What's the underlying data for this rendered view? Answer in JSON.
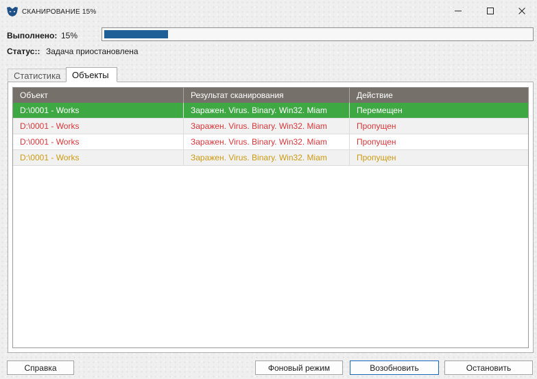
{
  "window": {
    "title": "СКАНИРОВАНИЕ 15%",
    "controls": [
      "minimize-icon",
      "maximize-icon",
      "close-icon"
    ]
  },
  "progress": {
    "label": "Выполнено:",
    "value_text": "15%",
    "value": 0.15
  },
  "status": {
    "label": "Статус::",
    "value": "Задача приостановлена"
  },
  "tabs": [
    {
      "label": "Статистика",
      "active": false
    },
    {
      "label": "Объекты",
      "active": true
    }
  ],
  "table": {
    "columns": [
      "Объект",
      "Результат сканирования",
      "Действие"
    ],
    "rows": [
      {
        "object": "D:\\0001 - Works",
        "result": "Заражен. Virus. Binary. Win32. Miam",
        "action": "Перемещен",
        "color": "#ffffff",
        "bg": "#3ea843"
      },
      {
        "object": "D:\\0001 - Works",
        "result": "Заражен. Virus. Binary. Win32. Miam",
        "action": "Пропущен",
        "color": "#d9363a",
        "bg": "#f1f1f1"
      },
      {
        "object": "D:\\0001 - Works",
        "result": "Заражен. Virus. Binary. Win32. Miam",
        "action": "Пропущен",
        "color": "#d9363a",
        "bg": "#ffffff"
      },
      {
        "object": "D:\\0001 - Works",
        "result": "Заражен. Virus. Binary. Win32. Miam",
        "action": "Пропущен",
        "color": "#cc9a12",
        "bg": "#f1f1f1"
      }
    ]
  },
  "buttons": {
    "help": "Справка",
    "background": "Фоновый режим",
    "resume": "Возобновить",
    "stop": "Остановить"
  },
  "colors": {
    "progress_fill": "#1d5f96",
    "header_bg": "#757069",
    "focus_border": "#1a66b8"
  }
}
